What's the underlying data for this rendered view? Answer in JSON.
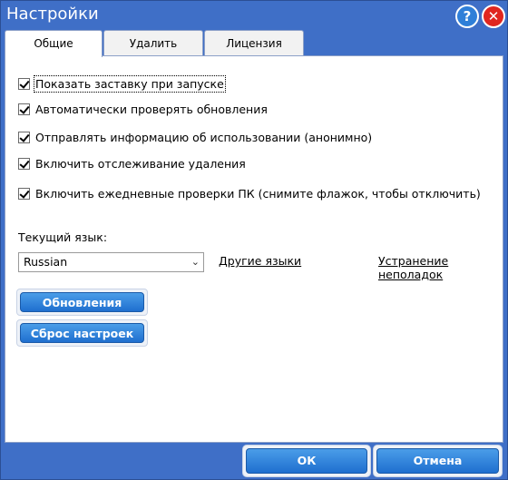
{
  "window": {
    "title": "Настройки",
    "help_label": "?",
    "close_label": "✕"
  },
  "tabs": [
    {
      "label": "Общие",
      "active": true
    },
    {
      "label": "Удалить",
      "active": false
    },
    {
      "label": "Лицензия",
      "active": false
    }
  ],
  "general": {
    "checkboxes": [
      {
        "label": "Показать заставку при запуске",
        "checked": true
      },
      {
        "label": "Автоматически проверять обновления",
        "checked": true
      },
      {
        "label": "Отправлять информацию об использовании (анонимно)",
        "checked": true
      },
      {
        "label": "Включить отслеживание удаления",
        "checked": true
      },
      {
        "label": "Включить ежедневные проверки ПК (снимите флажок, чтобы отключить)",
        "checked": true
      }
    ],
    "language_label": "Текущий язык:",
    "language_value": "Russian",
    "other_languages_link": "Другие языки",
    "troubleshooting_link": "Устранение неполадок",
    "updates_button": "Обновления",
    "reset_button": "Сброс настроек"
  },
  "footer": {
    "ok_button": "ОК",
    "cancel_button": "Отмена"
  }
}
